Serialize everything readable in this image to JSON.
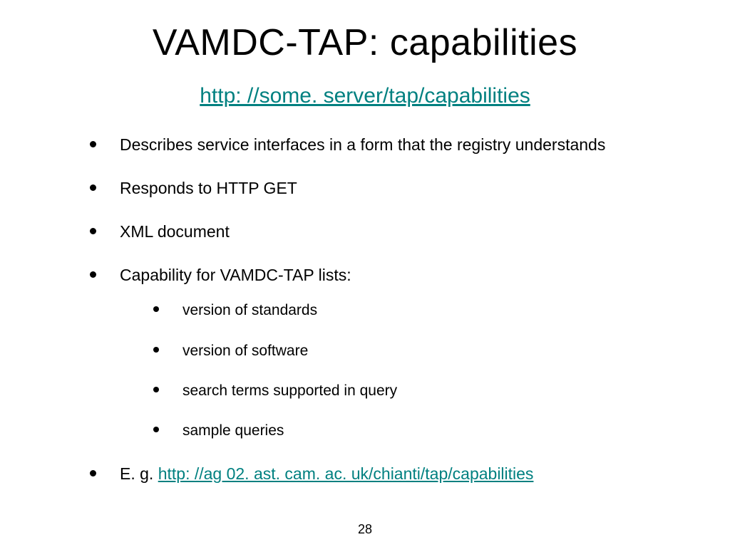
{
  "title": "VAMDC-TAP: capabilities",
  "subtitle_link_text": "http: //some. server/tap/capabilities",
  "bullets": {
    "b0": "Describes service interfaces in a form that the registry understands",
    "b1": "Responds to HTTP GET",
    "b2": "XML document",
    "b3": "Capability for VAMDC-TAP lists:",
    "sub": {
      "s0": "version of standards",
      "s1": "version of software",
      "s2": "search terms supported in query",
      "s3": "sample queries"
    },
    "b4_prefix": "E. g. ",
    "b4_link": "http: //ag 02. ast. cam. ac. uk/chianti/tap/capabilities"
  },
  "page_number": "28"
}
